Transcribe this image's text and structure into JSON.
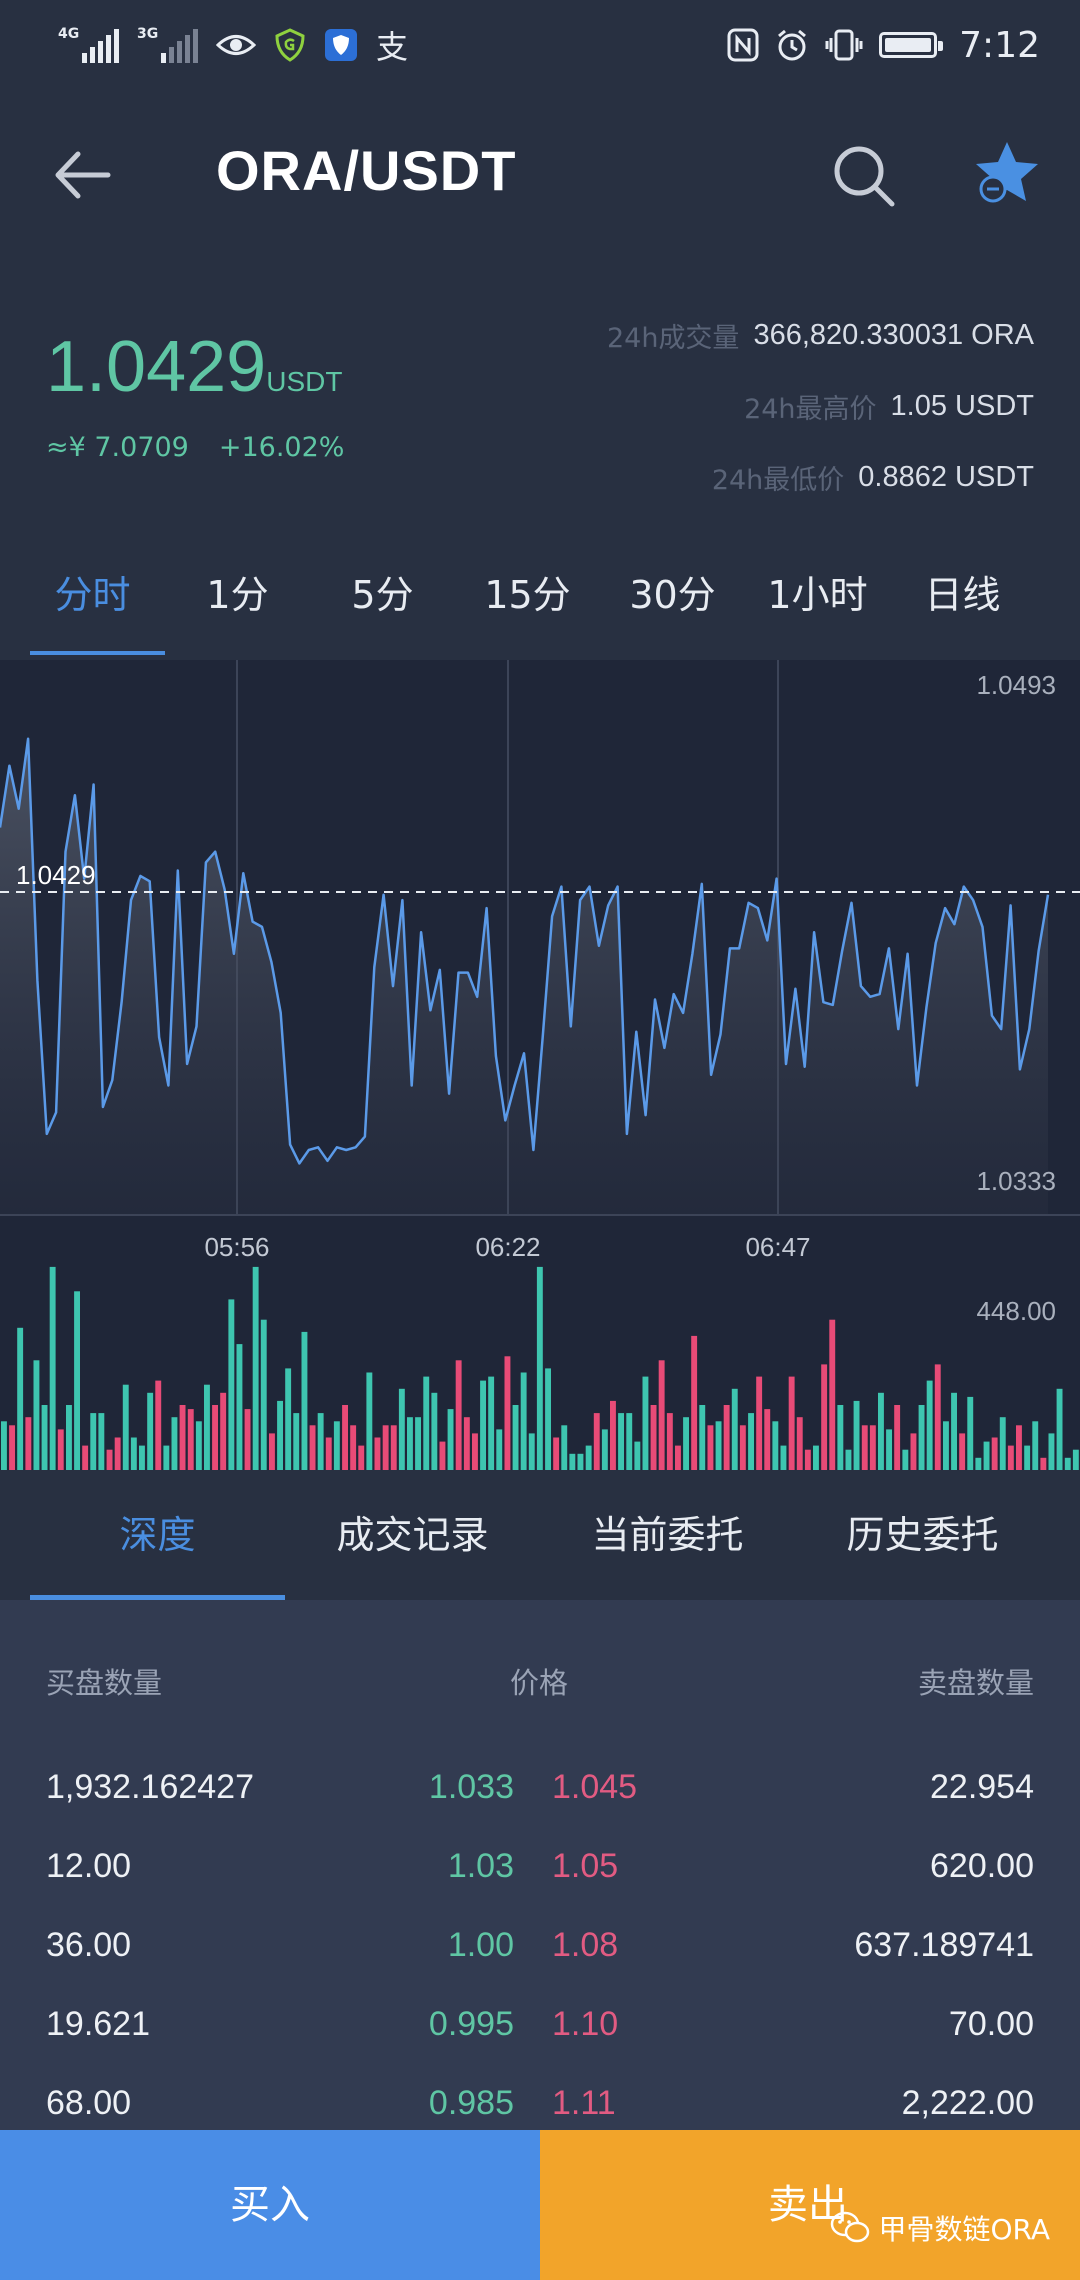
{
  "status_bar": {
    "net1": "4G",
    "net2": "3G",
    "alipay_glyph": "支",
    "time": "7:12",
    "icons": [
      "signal-icon",
      "eye-icon",
      "shield-g-icon",
      "shield-icon",
      "alipay-icon",
      "nfc-icon",
      "alarm-icon",
      "vibrate-icon",
      "battery-icon"
    ]
  },
  "header": {
    "title": "ORA/USDT",
    "icons": [
      "back-arrow-icon",
      "search-icon",
      "favorite-star-icon"
    ]
  },
  "ticker": {
    "price": "1.0429",
    "unit": "USDT",
    "cny": "≈¥ 7.0709",
    "change": "+16.02%",
    "volume_label": "24h成交量",
    "volume_value": "366,820.330031 ORA",
    "high_label": "24h最高价",
    "high_value": "1.05 USDT",
    "low_label": "24h最低价",
    "low_value": "0.8862 USDT"
  },
  "period_tabs": [
    "分时",
    "1分",
    "5分",
    "15分",
    "30分",
    "1小时",
    "日线"
  ],
  "colors": {
    "up": "#5fc6a4",
    "down": "#e25b82",
    "accent": "#4a8ee0",
    "line": "#5b9ae8",
    "vol_up": "#3ec6b0",
    "vol_down": "#e84b77"
  },
  "chart_data": {
    "type": "line",
    "current_price_label": "1.0429",
    "y_max_label": "1.0493",
    "y_min_label": "1.0333",
    "ylim": [
      1.0333,
      1.0493
    ],
    "current_price": 1.0429,
    "time_labels": [
      "05:56",
      "06:22",
      "06:47"
    ],
    "values": [
      1.0453,
      1.0476,
      1.046,
      1.0486,
      1.0396,
      1.0339,
      1.0347,
      1.0444,
      1.0465,
      1.0434,
      1.0469,
      1.0349,
      1.0359,
      1.0388,
      1.0426,
      1.0435,
      1.0433,
      1.0375,
      1.0357,
      1.0437,
      1.0365,
      1.0379,
      1.044,
      1.0444,
      1.043,
      1.0406,
      1.0436,
      1.0418,
      1.0416,
      1.0403,
      1.0384,
      1.0335,
      1.0328,
      1.0333,
      1.0334,
      1.0329,
      1.0334,
      1.0333,
      1.0334,
      1.0338,
      1.0401,
      1.0428,
      1.0394,
      1.0426,
      1.0357,
      1.0414,
      1.0385,
      1.04,
      1.0354,
      1.0399,
      1.0399,
      1.039,
      1.0423,
      1.0368,
      1.0344,
      1.0357,
      1.0369,
      1.0333,
      1.0375,
      1.042,
      1.0431,
      1.0379,
      1.0426,
      1.0431,
      1.0409,
      1.0424,
      1.0431,
      1.0339,
      1.0377,
      1.0346,
      1.0389,
      1.0371,
      1.0391,
      1.0384,
      1.0406,
      1.0432,
      1.0361,
      1.0376,
      1.0408,
      1.0408,
      1.0425,
      1.0423,
      1.0411,
      1.0434,
      1.0365,
      1.0393,
      1.0364,
      1.0414,
      1.0388,
      1.0387,
      1.0407,
      1.0425,
      1.0394,
      1.039,
      1.0391,
      1.0408,
      1.0378,
      1.0406,
      1.0357,
      1.0386,
      1.041,
      1.0423,
      1.0417,
      1.0431,
      1.0426,
      1.0416,
      1.0383,
      1.0378,
      1.0424,
      1.0363,
      1.0378,
      1.0407,
      1.0428
    ],
    "volume_max_label": "448.00",
    "volume_max": 448,
    "volume": [
      [
        120,
        1
      ],
      [
        110,
        0
      ],
      [
        350,
        1
      ],
      [
        130,
        0
      ],
      [
        270,
        1
      ],
      [
        160,
        1
      ],
      [
        500,
        1
      ],
      [
        100,
        0
      ],
      [
        160,
        1
      ],
      [
        440,
        1
      ],
      [
        60,
        0
      ],
      [
        140,
        1
      ],
      [
        140,
        1
      ],
      [
        50,
        0
      ],
      [
        80,
        0
      ],
      [
        210,
        1
      ],
      [
        80,
        1
      ],
      [
        60,
        1
      ],
      [
        190,
        1
      ],
      [
        220,
        0
      ],
      [
        60,
        1
      ],
      [
        130,
        1
      ],
      [
        160,
        0
      ],
      [
        150,
        0
      ],
      [
        120,
        1
      ],
      [
        210,
        1
      ],
      [
        160,
        0
      ],
      [
        190,
        0
      ],
      [
        420,
        1
      ],
      [
        310,
        1
      ],
      [
        150,
        0
      ],
      [
        500,
        1
      ],
      [
        370,
        1
      ],
      [
        90,
        0
      ],
      [
        170,
        1
      ],
      [
        250,
        1
      ],
      [
        140,
        1
      ],
      [
        340,
        1
      ],
      [
        110,
        0
      ],
      [
        140,
        1
      ],
      [
        80,
        0
      ],
      [
        120,
        1
      ],
      [
        160,
        0
      ],
      [
        110,
        0
      ],
      [
        60,
        0
      ],
      [
        240,
        1
      ],
      [
        80,
        0
      ],
      [
        110,
        0
      ],
      [
        110,
        0
      ],
      [
        200,
        1
      ],
      [
        130,
        1
      ],
      [
        130,
        1
      ],
      [
        230,
        1
      ],
      [
        190,
        1
      ],
      [
        70,
        0
      ],
      [
        150,
        1
      ],
      [
        270,
        0
      ],
      [
        130,
        0
      ],
      [
        90,
        0
      ],
      [
        220,
        1
      ],
      [
        230,
        1
      ],
      [
        100,
        1
      ],
      [
        280,
        0
      ],
      [
        160,
        1
      ],
      [
        240,
        1
      ],
      [
        90,
        1
      ],
      [
        500,
        1
      ],
      [
        250,
        1
      ],
      [
        80,
        0
      ],
      [
        110,
        1
      ],
      [
        40,
        1
      ],
      [
        40,
        1
      ],
      [
        60,
        1
      ],
      [
        140,
        0
      ],
      [
        100,
        1
      ],
      [
        170,
        0
      ],
      [
        140,
        1
      ],
      [
        140,
        1
      ],
      [
        70,
        1
      ],
      [
        230,
        1
      ],
      [
        160,
        0
      ],
      [
        270,
        0
      ],
      [
        140,
        0
      ],
      [
        60,
        0
      ],
      [
        130,
        1
      ],
      [
        330,
        0
      ],
      [
        160,
        1
      ],
      [
        110,
        0
      ],
      [
        120,
        1
      ],
      [
        160,
        0
      ],
      [
        200,
        1
      ],
      [
        110,
        0
      ],
      [
        140,
        1
      ],
      [
        230,
        0
      ],
      [
        150,
        0
      ],
      [
        120,
        1
      ],
      [
        60,
        1
      ],
      [
        230,
        0
      ],
      [
        130,
        0
      ],
      [
        50,
        0
      ],
      [
        60,
        1
      ],
      [
        260,
        0
      ],
      [
        370,
        0
      ],
      [
        160,
        1
      ],
      [
        50,
        1
      ],
      [
        170,
        1
      ],
      [
        110,
        0
      ],
      [
        110,
        0
      ],
      [
        190,
        1
      ],
      [
        100,
        1
      ],
      [
        160,
        0
      ],
      [
        50,
        1
      ],
      [
        90,
        0
      ],
      [
        160,
        1
      ],
      [
        220,
        1
      ],
      [
        260,
        0
      ],
      [
        120,
        1
      ],
      [
        190,
        1
      ],
      [
        90,
        0
      ],
      [
        180,
        1
      ],
      [
        30,
        1
      ],
      [
        70,
        1
      ],
      [
        80,
        0
      ],
      [
        130,
        1
      ],
      [
        60,
        0
      ],
      [
        110,
        0
      ],
      [
        60,
        1
      ],
      [
        120,
        1
      ],
      [
        30,
        0
      ],
      [
        90,
        1
      ],
      [
        200,
        1
      ],
      [
        30,
        1
      ],
      [
        50,
        1
      ]
    ]
  },
  "lower_tabs": [
    "深度",
    "成交记录",
    "当前委托",
    "历史委托"
  ],
  "order_book": {
    "headers": {
      "bid_qty": "买盘数量",
      "price": "价格",
      "ask_qty": "卖盘数量"
    },
    "rows": [
      {
        "bid_qty": "1,932.162427",
        "bid_price": "1.033",
        "ask_price": "1.045",
        "ask_qty": "22.954"
      },
      {
        "bid_qty": "12.00",
        "bid_price": "1.03",
        "ask_price": "1.05",
        "ask_qty": "620.00"
      },
      {
        "bid_qty": "36.00",
        "bid_price": "1.00",
        "ask_price": "1.08",
        "ask_qty": "637.189741"
      },
      {
        "bid_qty": "19.621",
        "bid_price": "0.995",
        "ask_price": "1.10",
        "ask_qty": "70.00"
      },
      {
        "bid_qty": "68.00",
        "bid_price": "0.985",
        "ask_price": "1.11",
        "ask_qty": "2,222.00"
      }
    ]
  },
  "actions": {
    "buy": "买入",
    "sell": "卖出"
  },
  "watermark": "甲骨数链ORA"
}
